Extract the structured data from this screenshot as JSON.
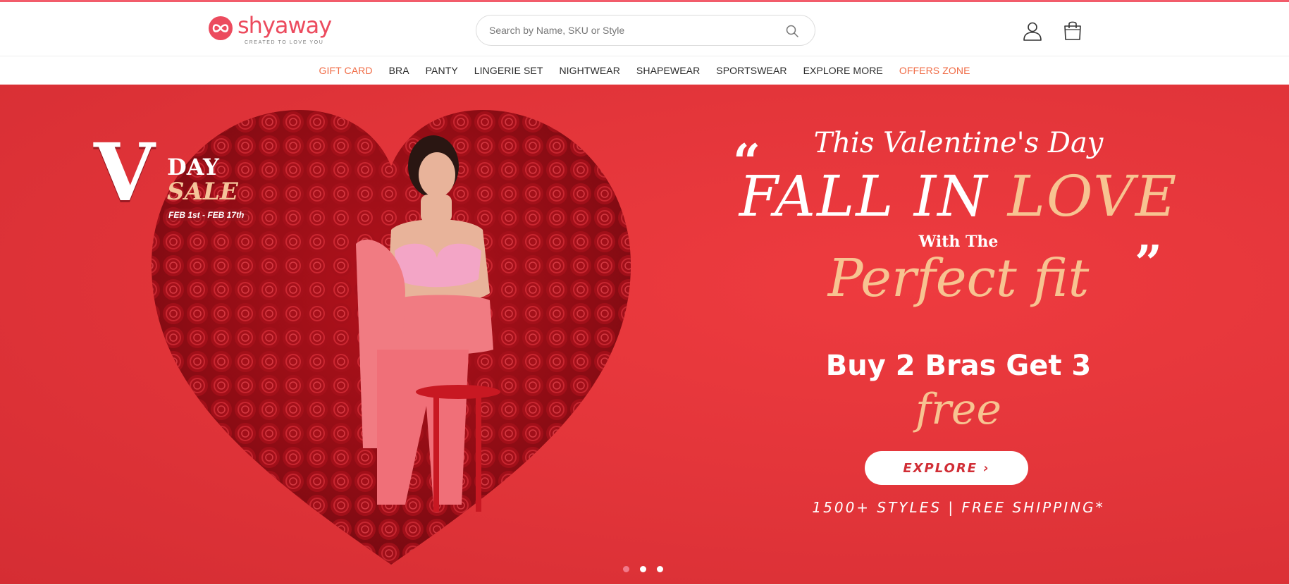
{
  "brand": {
    "name": "shyaway",
    "tagline": "CREATED TO LOVE YOU",
    "accent_color": "#ec4b5e"
  },
  "search": {
    "placeholder": "Search by Name, SKU or Style",
    "icon": "search-icon"
  },
  "header_icons": {
    "account": "user-icon",
    "cart": "bag-icon"
  },
  "nav": {
    "items": [
      {
        "label": "GIFT CARD",
        "highlight": true
      },
      {
        "label": "BRA",
        "highlight": false
      },
      {
        "label": "PANTY",
        "highlight": false
      },
      {
        "label": "LINGERIE SET",
        "highlight": false
      },
      {
        "label": "NIGHTWEAR",
        "highlight": false
      },
      {
        "label": "SHAPEWEAR",
        "highlight": false
      },
      {
        "label": "SPORTSWEAR",
        "highlight": false
      },
      {
        "label": "EXPLORE MORE",
        "highlight": false
      },
      {
        "label": "OFFERS ZONE",
        "highlight": true
      }
    ],
    "highlight_color": "#f06b45"
  },
  "hero": {
    "background_color": "#e13439",
    "badge": {
      "v": "V",
      "day": "DAY",
      "sale": "SALE",
      "dates": "FEB 1st - FEB 17th"
    },
    "quote_open": "“",
    "quote_close": "”",
    "line1": "This Valentine's Day",
    "line2_a": "FALL IN ",
    "line2_b": "LOVE",
    "line3": "With The",
    "line4": "Perfect fit",
    "offer_line1": "Buy 2 Bras Get 3",
    "offer_line2": "free",
    "cta_label": "EXPLORE ›",
    "features": "1500+ STYLES | FREE SHIPPING*",
    "carousel": {
      "slides": 3,
      "active_index": 0
    }
  }
}
